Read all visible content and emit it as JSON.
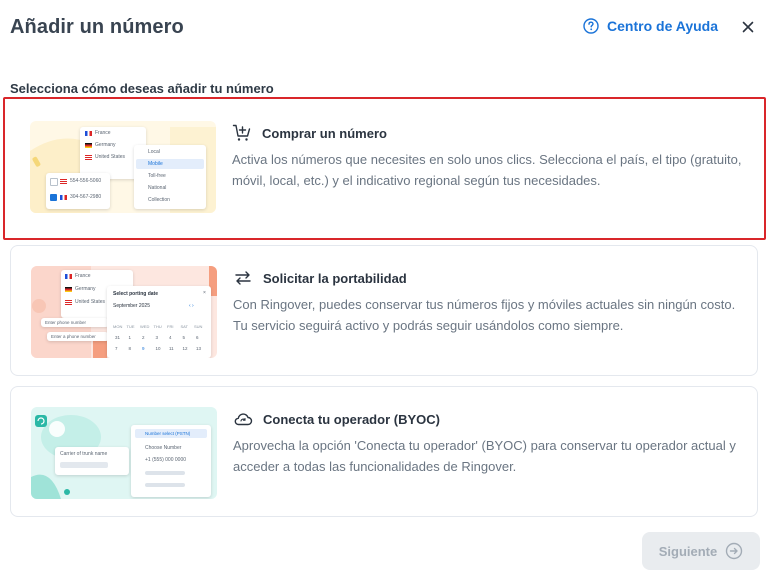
{
  "header": {
    "title": "Añadir un número",
    "help_label": "Centro de Ayuda"
  },
  "subtitle": "Selecciona cómo deseas añadir tu número",
  "options": [
    {
      "title": "Comprar un número",
      "description": "Activa los números que necesites en solo unos clics. Selecciona el país, el tipo (gratuito, móvil, local, etc.) y el indicativo regional según tus necesidades.",
      "icon": "cart-plus-icon",
      "selected": true,
      "illustration": {
        "countries": [
          "France",
          "Germany",
          "United States"
        ],
        "types": [
          "Local",
          "Mobile",
          "Toll-free",
          "National",
          "Collection"
        ],
        "numbers": [
          "554-556-5060",
          "304-567-2980"
        ]
      }
    },
    {
      "title": "Solicitar la portabilidad",
      "description": "Con Ringover, puedes conservar tus números fijos y móviles actuales sin ningún costo. Tu servicio seguirá activo y podrás seguir usándolos como siempre.",
      "icon": "swap-arrows-icon",
      "selected": false,
      "illustration": {
        "countries": [
          "France",
          "Germany",
          "United States"
        ],
        "calendar_title": "Select porting date",
        "month": "September 2025",
        "weekdays": [
          "MON",
          "TUE",
          "WED",
          "THU",
          "FRI",
          "SAT",
          "SUN"
        ],
        "days": [
          "31",
          "1",
          "2",
          "3",
          "4",
          "5",
          "6",
          "7",
          "8",
          "9",
          "10",
          "11",
          "12",
          "13"
        ],
        "fields": [
          "Enter phone number",
          "Enter a phone number"
        ]
      }
    },
    {
      "title": "Conecta tu operador (BYOC)",
      "description": "Aprovecha la opción 'Conecta tu operador' (BYOC) para conservar tu operador actual y acceder a todas las funcionalidades de Ringover.",
      "icon": "cloud-sync-icon",
      "selected": false,
      "illustration": {
        "field_label": "Carrier of trunk name",
        "list_title": "Number select (PSTN)",
        "list_items": [
          "Choose Number",
          "+1 (555) 000 0000"
        ]
      }
    }
  ],
  "footer": {
    "next_label": "Siguiente"
  },
  "colors": {
    "accent": "#1a73d8",
    "selected_border": "#d9262a",
    "disabled_bg": "#e9ecef"
  }
}
